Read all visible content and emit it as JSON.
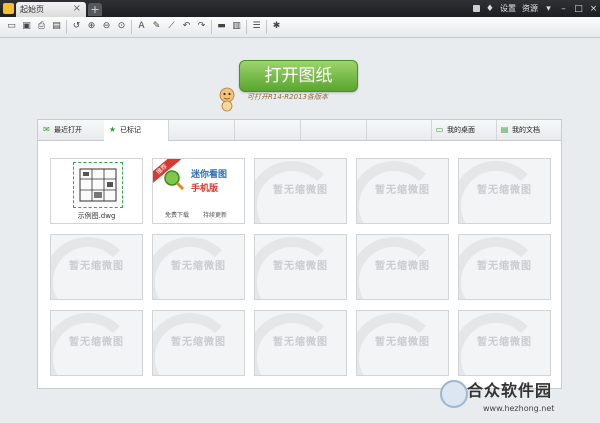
{
  "titlebar": {
    "tab_label": "起始页",
    "tab_close": "×",
    "new_tab": "+",
    "right_links": [
      "设置",
      "资源"
    ],
    "window_buttons": [
      "▾",
      "–",
      "□",
      "×"
    ]
  },
  "toolbar": {
    "icons": [
      "folder-open",
      "save",
      "print",
      "export",
      "undo",
      "zoom-in",
      "zoom-out",
      "zoom-window",
      "text",
      "pen",
      "measure",
      "rotate-left",
      "rotate-right",
      "ruler",
      "layer",
      "layers",
      "settings"
    ]
  },
  "open_button": {
    "label": "打开图纸",
    "tip": "可打开R14-R2013各版本"
  },
  "panel": {
    "tabs": [
      {
        "label": "最近打开",
        "icon": "mail-icon"
      },
      {
        "label": "已标记",
        "icon": "star-icon"
      },
      {
        "label": "",
        "icon": ""
      },
      {
        "label": "",
        "icon": ""
      },
      {
        "label": "",
        "icon": ""
      },
      {
        "label": "我的桌面",
        "icon": "desktop-icon"
      },
      {
        "label": "我的文档",
        "icon": "document-icon"
      }
    ],
    "cad_caption": "示例图.dwg",
    "mobile": {
      "badge": "推荐",
      "title1": "迷你看图",
      "title2": "手机版",
      "link1": "免费下载",
      "link2": "持续更新"
    },
    "placeholder_text": "暂无缩微图"
  },
  "watermark": {
    "brand": "合众软件园",
    "url": "www.hezhong.net"
  }
}
